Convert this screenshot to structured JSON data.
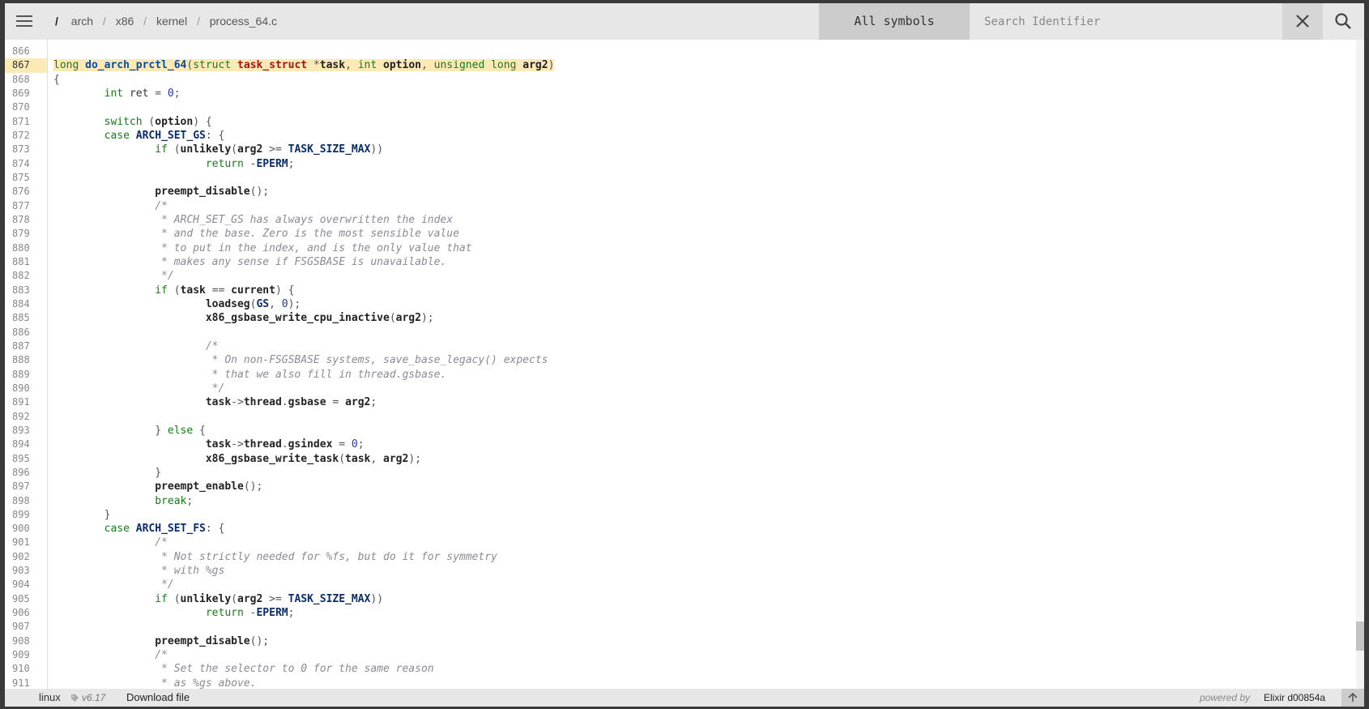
{
  "breadcrumb": {
    "root": "/",
    "parts": [
      "arch",
      "x86",
      "kernel",
      "process_64.c"
    ],
    "sep": "/"
  },
  "search": {
    "filter_label": "All symbols",
    "placeholder": "Search Identifier"
  },
  "icons": {
    "menu": "hamburger-menu-icon",
    "clear": "close-icon",
    "search": "search-icon",
    "tag": "tag-icon",
    "top": "arrow-up-icon"
  },
  "colors": {
    "highlight": "#fbeab5",
    "bar": "#e7e7e7"
  },
  "code": {
    "highlighted_line": 867,
    "line_numbers": [
      "866",
      "867",
      "868",
      "869",
      "870",
      "871",
      "872",
      "873",
      "874",
      "875",
      "876",
      "877",
      "878",
      "879",
      "880",
      "881",
      "882",
      "883",
      "884",
      "885",
      "886",
      "887",
      "888",
      "889",
      "890",
      "891",
      "892",
      "893",
      "894",
      "895",
      "896",
      "897",
      "898",
      "899",
      "900",
      "901",
      "902",
      "903",
      "904",
      "905",
      "906",
      "907",
      "908",
      "909",
      "910",
      "911"
    ],
    "lines": [
      "",
      "long do_arch_prctl_64(struct task_struct *task, int option, unsigned long arg2)",
      "{",
      "        int ret = 0;",
      "",
      "        switch (option) {",
      "        case ARCH_SET_GS: {",
      "                if (unlikely(arg2 >= TASK_SIZE_MAX))",
      "                        return -EPERM;",
      "",
      "                preempt_disable();",
      "                /*",
      "                 * ARCH_SET_GS has always overwritten the index",
      "                 * and the base. Zero is the most sensible value",
      "                 * to put in the index, and is the only value that",
      "                 * makes any sense if FSGSBASE is unavailable.",
      "                 */",
      "                if (task == current) {",
      "                        loadseg(GS, 0);",
      "                        x86_gsbase_write_cpu_inactive(arg2);",
      "",
      "                        /*",
      "                         * On non-FSGSBASE systems, save_base_legacy() expects",
      "                         * that we also fill in thread.gsbase.",
      "                         */",
      "                        task->thread.gsbase = arg2;",
      "",
      "                } else {",
      "                        task->thread.gsindex = 0;",
      "                        x86_gsbase_write_task(task, arg2);",
      "                }",
      "                preempt_enable();",
      "                break;",
      "        }",
      "        case ARCH_SET_FS: {",
      "                /*",
      "                 * Not strictly needed for %fs, but do it for symmetry",
      "                 * with %gs",
      "                 */",
      "                if (unlikely(arg2 >= TASK_SIZE_MAX))",
      "                        return -EPERM;",
      "",
      "                preempt_disable();",
      "                /*",
      "                 * Set the selector to 0 for the same reason",
      "                 * as %gs above."
    ]
  },
  "footer": {
    "project": "linux",
    "version": "v6.17",
    "download": "Download file",
    "powered_by": "powered by",
    "elixir": "Elixir d00854a"
  }
}
